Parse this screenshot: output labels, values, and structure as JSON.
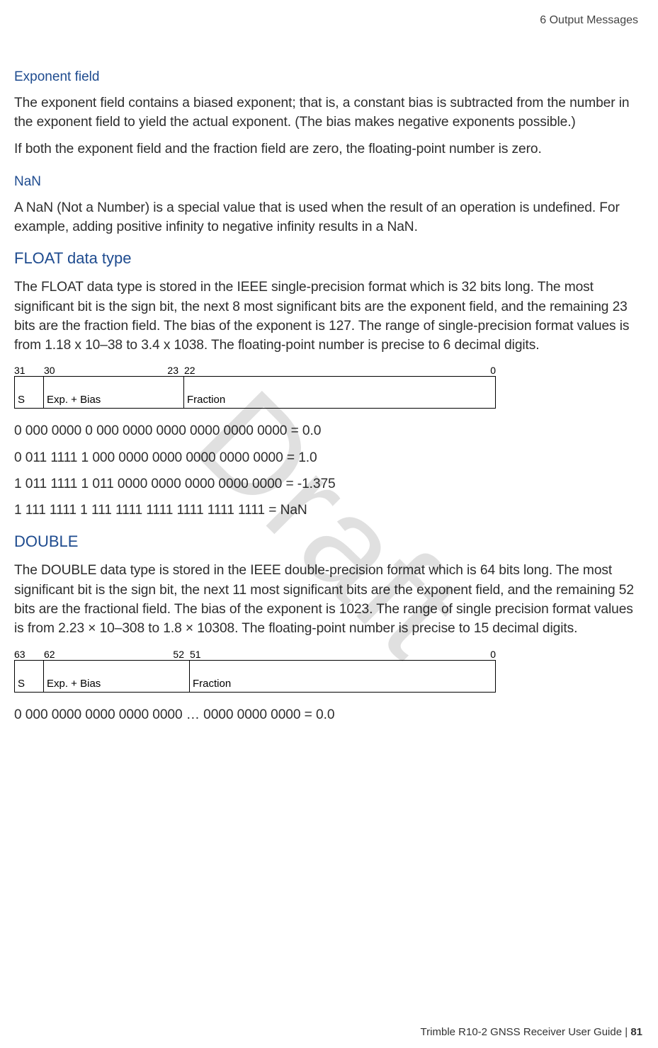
{
  "header": {
    "chapter": "6   Output Messages"
  },
  "watermark": "Draft",
  "sections": {
    "exponent": {
      "title": "Exponent field",
      "p1": "The exponent field contains a biased exponent; that is, a constant bias is subtracted from the number in the exponent field to yield the actual exponent. (The bias makes negative exponents possible.)",
      "p2": "If both the exponent field and the fraction field are zero, the floating-point number is zero."
    },
    "nan": {
      "title": "NaN",
      "p1": "A NaN (Not a Number) is a special value that is used when the result of an operation is undefined. For example, adding positive infinity to negative infinity results in a NaN."
    },
    "float": {
      "title": "FLOAT data type",
      "p1": "The FLOAT data type is stored in the IEEE single-precision format which is 32 bits long. The most significant bit is the sign bit, the next 8 most significant bits are the exponent field, and the remaining 23 bits are the fraction field. The bias of the exponent is 127. The range of single-precision format values is from 1.18 x 10–38 to 3.4 x 1038. The floating-point number is precise to 6 decimal digits.",
      "diagram": {
        "bits": {
          "b31": "31",
          "b30": "30",
          "b23": "23",
          "b22": "22",
          "b0": "0"
        },
        "labels": {
          "s": "S",
          "exp": "Exp. + Bias",
          "frac": "Fraction"
        }
      },
      "examples": {
        "e1": "0 000 0000 0 000 0000 0000 0000 0000 0000 = 0.0",
        "e2": "0 011 1111 1 000 0000 0000 0000 0000 0000 = 1.0",
        "e3": "1 011 1111 1 011 0000 0000 0000 0000 0000 = -1.375",
        "e4": "1 111 1111 1 111 1111 1111 1111 1111 1111 = NaN"
      }
    },
    "double": {
      "title": "DOUBLE",
      "p1": "The DOUBLE data type is stored in the IEEE double-precision format which is 64 bits long. The most significant bit is the sign bit, the next 11 most significant bits are the exponent field, and the remaining 52 bits are the fractional field. The bias of the exponent is 1023. The range of single precision format values is from 2.23 × 10–308 to 1.8 × 10308. The floating-point number is precise to 15 decimal digits.",
      "diagram": {
        "bits": {
          "b63": "63",
          "b62": "62",
          "b52": "52",
          "b51": "51",
          "b0": "0"
        },
        "labels": {
          "s": "S",
          "exp": "Exp. + Bias",
          "frac": "Fraction"
        }
      },
      "examples": {
        "e1": "0 000 0000 0000 0000 0000 … 0000 0000 0000 = 0.0"
      }
    }
  },
  "footer": {
    "text": "Trimble R10-2 GNSS Receiver User Guide | ",
    "page": "81"
  }
}
